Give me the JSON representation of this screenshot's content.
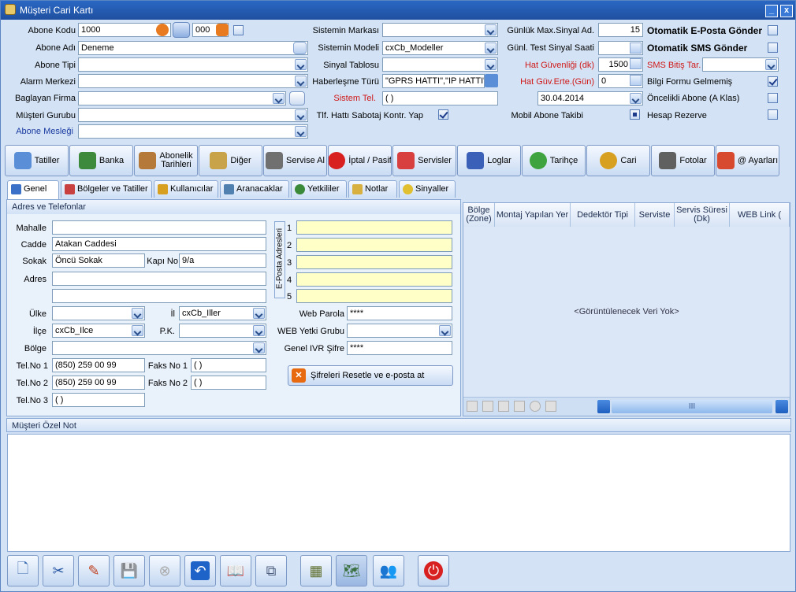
{
  "window": {
    "title": "Müşteri Cari Kartı",
    "min": "_",
    "close": "x"
  },
  "form": {
    "abone_kodu_label": "Abone Kodu",
    "abone_kodu": "1000",
    "abone_kodu_suffix": "000",
    "abone_adi_label": "Abone Adı",
    "abone_adi": "Deneme",
    "abone_tipi_label": "Abone Tipi",
    "alarm_merkezi_label": "Alarm Merkezi",
    "baglayan_firma_label": "Baglayan Firma",
    "musteri_gurubu_label": "Müşteri Gurubu",
    "abone_meslegi_label": "Abone Mesleği",
    "sistemin_markasi_label": "Sistemin Markası",
    "sistemin_modeli_label": "Sistemin Modeli",
    "sistemin_modeli": "cxCb_Modeller",
    "sinyal_tablosu_label": "Sinyal Tablosu",
    "haberlesme_turu_label": "Haberleşme Türü",
    "haberlesme_turu": "\"GPRS HATTI\",\"IP HATTI\"",
    "sistem_tel_label": "Sistem Tel.",
    "sistem_tel": "(  )",
    "sabotaj_label": "Tlf. Hattı Sabotaj Kontr. Yap",
    "gunluk_max_label": "Günlük Max.Sinyal  Ad.",
    "gunluk_max": "15",
    "gunl_test_label": "Günl. Test Sinyal Saati",
    "hat_guvenligi_label": "Hat Güvenliği (dk)",
    "hat_guvenligi": "1500",
    "hat_guv_erte_label": "Hat Güv.Erte.(Gün)",
    "hat_guv_erte": "0",
    "tarih": "30.04.2014",
    "mobil_abone_label": "Mobil Abone Takibi",
    "oto_eposta_label": "Otomatik E-Posta Gönder",
    "oto_sms_label": "Otomatik SMS Gönder",
    "sms_bitis_label": "SMS Bitiş Tar.",
    "bilgi_formu_label": "Bilgi Formu Gelmemiş",
    "oncelikli_label": "Öncelikli Abone (A Klas)",
    "hesap_rezerve_label": "Hesap Rezerve"
  },
  "actions": [
    {
      "label": "Tatiller",
      "color": "#5a8fd8"
    },
    {
      "label": "Banka",
      "color": "#3d8a3d"
    },
    {
      "label": "Abonelik Tarihleri",
      "color": "#b57a3a"
    },
    {
      "label": "Diğer",
      "color": "#c8a34a"
    },
    {
      "label": "Servise Al",
      "color": "#707070"
    },
    {
      "label": "İptal / Pasif",
      "color": "#d82020"
    },
    {
      "label": "Servisler",
      "color": "#d84040"
    },
    {
      "label": "Loglar",
      "color": "#3a60b8"
    },
    {
      "label": "Tarihçe",
      "color": "#3fa33f"
    },
    {
      "label": "Cari",
      "color": "#d8a020"
    },
    {
      "label": "Fotolar",
      "color": "#606060"
    },
    {
      "label": "@ Ayarları",
      "color": "#d84a30"
    }
  ],
  "tabs": [
    {
      "label": "Genel",
      "color": "#3a70c8"
    },
    {
      "label": "Bölgeler ve Tatiller",
      "color": "#c84040"
    },
    {
      "label": "Kullanıcılar",
      "color": "#d8a020"
    },
    {
      "label": "Aranacaklar",
      "color": "#5080b0"
    },
    {
      "label": "Yetkililer",
      "color": "#3a8a3a"
    },
    {
      "label": "Notlar",
      "color": "#d8b040"
    },
    {
      "label": "Sinyaller",
      "color": "#e0c030"
    }
  ],
  "address": {
    "section": "Adres ve Telefonlar",
    "mahalle_label": "Mahalle",
    "cadde_label": "Cadde",
    "cadde": "Atakan Caddesi",
    "sokak_label": "Sokak",
    "sokak": "Öncü Sokak",
    "kapi_no_label": "Kapı No",
    "kapi_no": "9/a",
    "adres_label": "Adres",
    "ulke_label": "Ülke",
    "il_label": "İl",
    "il": "cxCb_Iller",
    "ilce_label": "İlçe",
    "ilce": "cxCb_Ilce",
    "pk_label": "P.K.",
    "bolge_label": "Bölge",
    "tel1_label": "Tel.No 1",
    "tel1": "(850) 259 00 99",
    "tel2_label": "Tel.No 2",
    "tel2": "(850) 259 00 99",
    "tel3_label": "Tel.No 3",
    "tel3": "(  )",
    "faks1_label": "Faks No 1",
    "faks1": "(  )",
    "faks2_label": "Faks No 2",
    "faks2": "(  )",
    "eposta_label": "E-Posta Adresleri",
    "eposta_nums": [
      "1",
      "2",
      "3",
      "4",
      "5"
    ],
    "web_parola_label": "Web Parola",
    "web_parola": "****",
    "web_yetki_label": "WEB Yetki Grubu",
    "ivr_label": "Genel IVR Şifre",
    "ivr": "****",
    "reset_button": "Şifreleri Resetle ve e-posta at"
  },
  "grid": {
    "columns": [
      "Bölge (Zone)",
      "Montaj Yapılan Yer",
      "Dedektör Tipi",
      "Serviste",
      "Servis Süresi (Dk)",
      "WEB Link ("
    ],
    "empty": "<Görüntülenecek Veri Yok>",
    "scroll_mid": "III"
  },
  "note": {
    "section": "Müşteri Özel Not"
  },
  "toolbar": [
    {
      "name": "new-doc-icon",
      "glyph": "🗋"
    },
    {
      "name": "cut-icon",
      "glyph": "✂"
    },
    {
      "name": "edit-icon",
      "glyph": "✎"
    },
    {
      "name": "save-icon",
      "glyph": "💾"
    },
    {
      "name": "cancel-icon",
      "glyph": "⊗"
    },
    {
      "name": "undo-icon",
      "glyph": "↶"
    },
    {
      "name": "book-icon",
      "glyph": "📖"
    },
    {
      "name": "copy-icon",
      "glyph": "⧉"
    },
    {
      "name": "device-icon",
      "glyph": "▦"
    },
    {
      "name": "map-icon",
      "glyph": "🗺"
    },
    {
      "name": "users-icon",
      "glyph": "👥"
    },
    {
      "name": "power-icon",
      "glyph": "⏻"
    }
  ]
}
